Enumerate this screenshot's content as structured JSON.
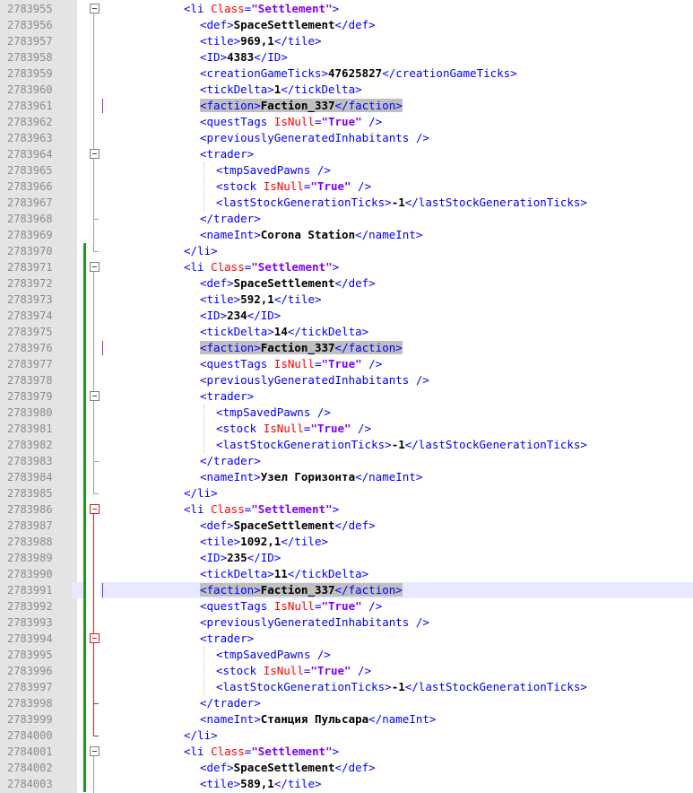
{
  "editor": {
    "name": "xml-editor",
    "lines": [
      {
        "num": "2783955",
        "text": "<li Class=\"Settlement\">"
      },
      {
        "num": "2783956",
        "text": "<def>SpaceSettlement</def>"
      },
      {
        "num": "2783957",
        "text": "<tile>969,1</tile>"
      },
      {
        "num": "2783958",
        "text": "<ID>4383</ID>"
      },
      {
        "num": "2783959",
        "text": "<creationGameTicks>47625827</creationGameTicks>"
      },
      {
        "num": "2783960",
        "text": "<tickDelta>1</tickDelta>"
      },
      {
        "num": "2783961",
        "text": "<faction>Faction_337</faction>"
      },
      {
        "num": "2783962",
        "text": "<questTags IsNull=\"True\" />"
      },
      {
        "num": "2783963",
        "text": "<previouslyGeneratedInhabitants />"
      },
      {
        "num": "2783964",
        "text": "<trader>"
      },
      {
        "num": "2783965",
        "text": "<tmpSavedPawns />"
      },
      {
        "num": "2783966",
        "text": "<stock IsNull=\"True\" />"
      },
      {
        "num": "2783967",
        "text": "<lastStockGenerationTicks>-1</lastStockGenerationTicks>"
      },
      {
        "num": "2783968",
        "text": "</trader>"
      },
      {
        "num": "2783969",
        "text": "<nameInt>Corona Station</nameInt>"
      },
      {
        "num": "2783970",
        "text": "</li>"
      },
      {
        "num": "2783971",
        "text": "<li Class=\"Settlement\">"
      },
      {
        "num": "2783972",
        "text": "<def>SpaceSettlement</def>"
      },
      {
        "num": "2783973",
        "text": "<tile>592,1</tile>"
      },
      {
        "num": "2783974",
        "text": "<ID>234</ID>"
      },
      {
        "num": "2783975",
        "text": "<tickDelta>14</tickDelta>"
      },
      {
        "num": "2783976",
        "text": "<faction>Faction_337</faction>"
      },
      {
        "num": "2783977",
        "text": "<questTags IsNull=\"True\" />"
      },
      {
        "num": "2783978",
        "text": "<previouslyGeneratedInhabitants />"
      },
      {
        "num": "2783979",
        "text": "<trader>"
      },
      {
        "num": "2783980",
        "text": "<tmpSavedPawns />"
      },
      {
        "num": "2783981",
        "text": "<stock IsNull=\"True\" />"
      },
      {
        "num": "2783982",
        "text": "<lastStockGenerationTicks>-1</lastStockGenerationTicks>"
      },
      {
        "num": "2783983",
        "text": "</trader>"
      },
      {
        "num": "2783984",
        "text": "<nameInt>Узел Горизонта</nameInt>"
      },
      {
        "num": "2783985",
        "text": "</li>"
      },
      {
        "num": "2783986",
        "text": "<li Class=\"Settlement\">"
      },
      {
        "num": "2783987",
        "text": "<def>SpaceSettlement</def>"
      },
      {
        "num": "2783988",
        "text": "<tile>1092,1</tile>"
      },
      {
        "num": "2783989",
        "text": "<ID>235</ID>"
      },
      {
        "num": "2783990",
        "text": "<tickDelta>11</tickDelta>"
      },
      {
        "num": "2783991",
        "text": "<faction>Faction_337</faction>"
      },
      {
        "num": "2783992",
        "text": "<questTags IsNull=\"True\" />"
      },
      {
        "num": "2783993",
        "text": "<previouslyGeneratedInhabitants />"
      },
      {
        "num": "2783994",
        "text": "<trader>"
      },
      {
        "num": "2783995",
        "text": "<tmpSavedPawns />"
      },
      {
        "num": "2783996",
        "text": "<stock IsNull=\"True\" />"
      },
      {
        "num": "2783997",
        "text": "<lastStockGenerationTicks>-1</lastStockGenerationTicks>"
      },
      {
        "num": "2783998",
        "text": "</trader>"
      },
      {
        "num": "2783999",
        "text": "<nameInt>Станция Пульсара</nameInt>"
      },
      {
        "num": "2784000",
        "text": "</li>"
      },
      {
        "num": "2784001",
        "text": "<li Class=\"Settlement\">"
      },
      {
        "num": "2784002",
        "text": "<def>SpaceSettlement</def>"
      },
      {
        "num": "2784003",
        "text": "<tile>589,1</tile>"
      }
    ]
  },
  "colors": {
    "tag": "#0000ff",
    "attribute_name": "#ff0000",
    "attribute_value": "#8000ff",
    "text": "#000000",
    "highlight": "#c0c0c0",
    "current_line": "#e8e8ff",
    "change_marker": "#1e9a1e",
    "fold_active": "#d02020"
  }
}
